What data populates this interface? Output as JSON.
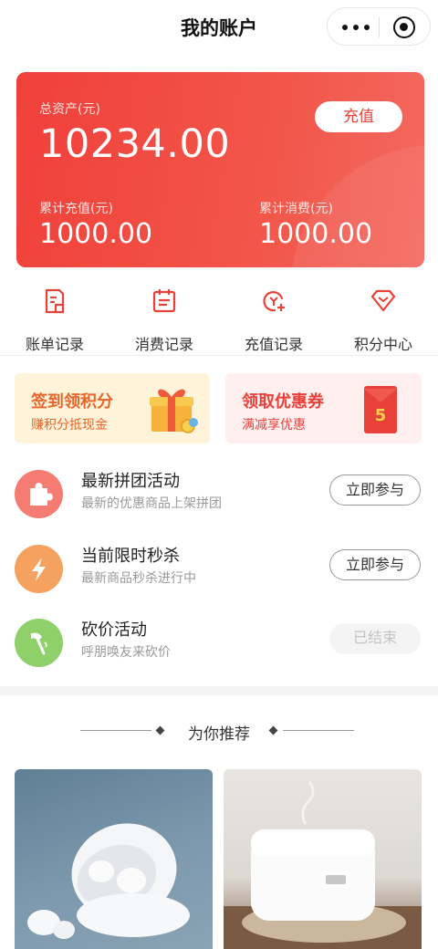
{
  "header": {
    "title": "我的账户"
  },
  "balance": {
    "total_label": "总资产(元)",
    "total_value": "10234.00",
    "recharge_button": "充值",
    "recharged_label": "累计充值(元)",
    "recharged_value": "1000.00",
    "consumed_label": "累计消费(元)",
    "consumed_value": "1000.00"
  },
  "quick_menu": [
    {
      "label": "账单记录",
      "icon": "bill-icon"
    },
    {
      "label": "消费记录",
      "icon": "calendar-icon"
    },
    {
      "label": "充值记录",
      "icon": "recharge-icon"
    },
    {
      "label": "积分中心",
      "icon": "diamond-icon"
    }
  ],
  "promos": [
    {
      "title": "签到领积分",
      "subtitle": "赚积分抵现金",
      "icon": "gift-icon"
    },
    {
      "title": "领取优惠券",
      "subtitle": "满减享优惠",
      "icon": "red-envelope-icon",
      "badge": "5"
    }
  ],
  "activities": [
    {
      "title": "最新拼团活动",
      "subtitle": "最新的优惠商品上架拼团",
      "button": "立即参与",
      "icon": "puzzle-icon",
      "color": "#f47c72"
    },
    {
      "title": "当前限时秒杀",
      "subtitle": "最新商品秒杀进行中",
      "button": "立即参与",
      "icon": "lightning-icon",
      "color": "#f5a15f"
    },
    {
      "title": "砍价活动",
      "subtitle": "呼朋唤友来砍价",
      "button": "已结束",
      "icon": "axe-icon",
      "color": "#8fd06a"
    }
  ],
  "recommend": {
    "title": "为你推荐"
  },
  "products": [
    {
      "name": "earbuds",
      "icon": "earbuds-image"
    },
    {
      "name": "rice-cooker",
      "icon": "rice-cooker-image"
    }
  ],
  "colors": {
    "accent": "#e8413a",
    "orange": "#e9652a"
  }
}
